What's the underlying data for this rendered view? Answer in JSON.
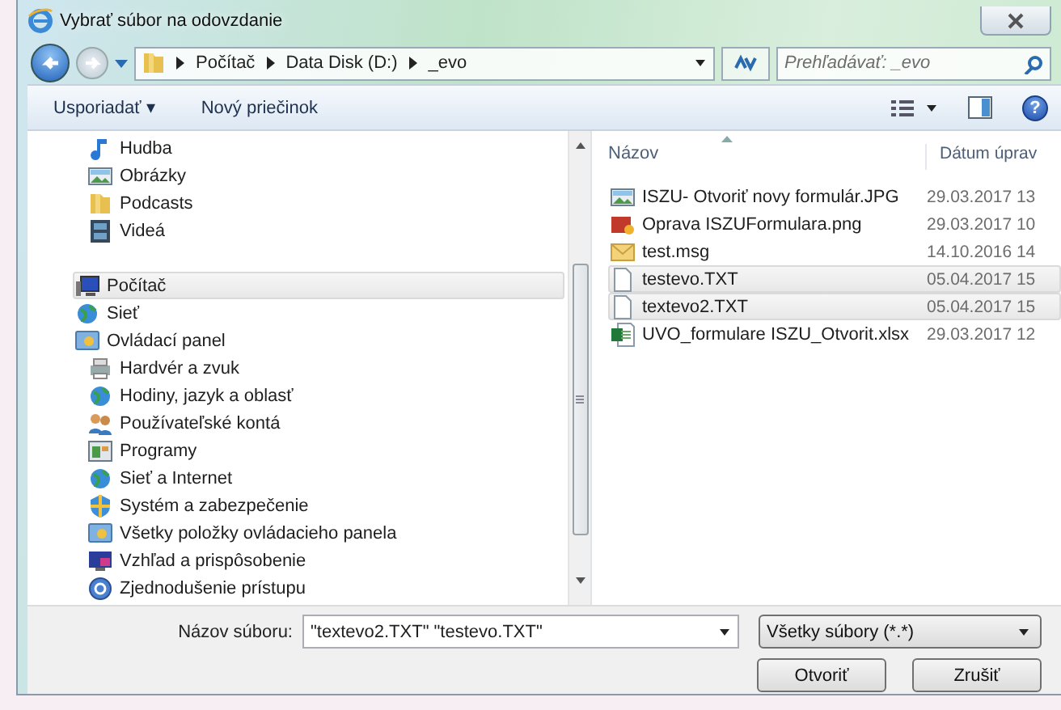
{
  "window": {
    "title": "Vybrať súbor na odovzdanie"
  },
  "address": {
    "crumbs": [
      "Počítač",
      "Data Disk (D:)",
      "_evo"
    ],
    "search_placeholder": "Prehľadávať: _evo"
  },
  "toolbar": {
    "organize": "Usporiadať ▾",
    "new_folder": "Nový priečinok",
    "help": "?"
  },
  "nav": {
    "library_items": [
      {
        "label": "Hudba",
        "selected": false
      },
      {
        "label": "Obrázky",
        "selected": false
      },
      {
        "label": "Podcasts",
        "selected": false
      },
      {
        "label": "Videá",
        "selected": false
      }
    ],
    "items": [
      {
        "label": "Počítač",
        "selected": true
      },
      {
        "label": "Sieť",
        "selected": false
      },
      {
        "label": "Ovládací panel",
        "selected": false,
        "children": [
          {
            "label": "Hardvér a zvuk",
            "selected": false
          },
          {
            "label": "Hodiny, jazyk a oblasť",
            "selected": false
          },
          {
            "label": "Používateľské kontá",
            "selected": false
          },
          {
            "label": "Programy",
            "selected": false
          },
          {
            "label": "Sieť a Internet",
            "selected": false
          },
          {
            "label": "Systém a zabezpečenie",
            "selected": false
          },
          {
            "label": "Všetky položky ovládacieho panela",
            "selected": false
          },
          {
            "label": "Vzhľad a prispôsobenie",
            "selected": false
          },
          {
            "label": "Zjednodušenie prístupu",
            "selected": false
          }
        ]
      }
    ]
  },
  "files": {
    "columns": [
      "Názov",
      "Dátum úprav"
    ],
    "rows": [
      {
        "name": "ISZU- Otvoriť novy formulár.JPG",
        "date": "29.03.2017 13",
        "selected": false
      },
      {
        "name": "Oprava ISZUFormulara.png",
        "date": "29.03.2017 10",
        "selected": false
      },
      {
        "name": "test.msg",
        "date": "14.10.2016 14",
        "selected": false
      },
      {
        "name": "testevo.TXT",
        "date": "05.04.2017 15",
        "selected": true
      },
      {
        "name": "textevo2.TXT",
        "date": "05.04.2017 15",
        "selected": true
      },
      {
        "name": "UVO_formulare ISZU_Otvorit.xlsx",
        "date": "29.03.2017 12",
        "selected": false
      }
    ]
  },
  "footer": {
    "filename_label": "Názov súboru:",
    "filename_value": "\"textevo2.TXT\" \"testevo.TXT\"",
    "filter": "Všetky súbory (*.*)",
    "open": "Otvoriť",
    "cancel": "Zrušiť"
  }
}
